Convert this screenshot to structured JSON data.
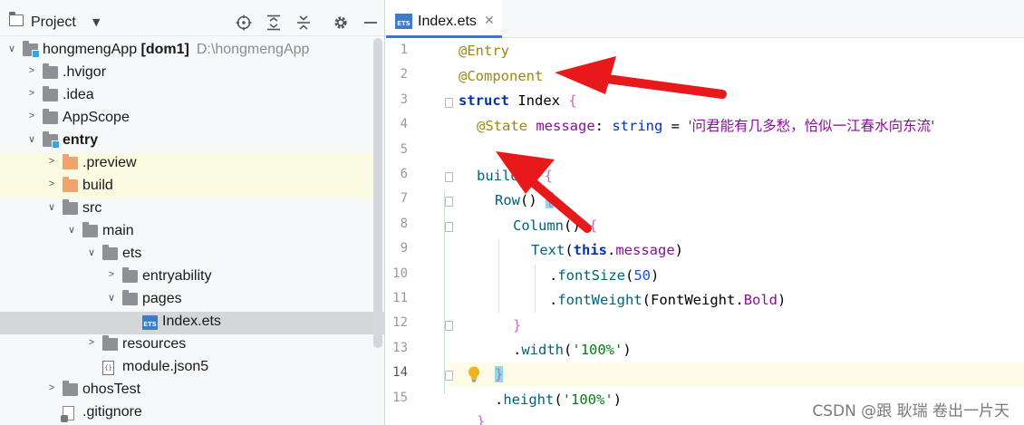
{
  "project_panel": {
    "title": "Project",
    "tree": [
      {
        "depth": 0,
        "arrow": "expanded",
        "icon": "module-folder",
        "label": "hongmengApp",
        "suffix": "[dom1]",
        "hint": "D:\\hongmengApp"
      },
      {
        "depth": 1,
        "arrow": "collapsed",
        "icon": "folder",
        "label": ".hvigor"
      },
      {
        "depth": 1,
        "arrow": "collapsed",
        "icon": "folder",
        "label": ".idea"
      },
      {
        "depth": 1,
        "arrow": "collapsed",
        "icon": "folder",
        "label": "AppScope"
      },
      {
        "depth": 1,
        "arrow": "expanded",
        "icon": "module-folder",
        "label": "entry",
        "bold": true
      },
      {
        "depth": 2,
        "arrow": "collapsed",
        "icon": "folder-orange",
        "label": ".preview",
        "highlight": true
      },
      {
        "depth": 2,
        "arrow": "collapsed",
        "icon": "folder-orange",
        "label": "build",
        "highlight": true
      },
      {
        "depth": 2,
        "arrow": "expanded",
        "icon": "folder",
        "label": "src"
      },
      {
        "depth": 3,
        "arrow": "expanded",
        "icon": "folder",
        "label": "main"
      },
      {
        "depth": 4,
        "arrow": "expanded",
        "icon": "folder",
        "label": "ets"
      },
      {
        "depth": 5,
        "arrow": "collapsed",
        "icon": "folder",
        "label": "entryability"
      },
      {
        "depth": 5,
        "arrow": "expanded",
        "icon": "folder",
        "label": "pages"
      },
      {
        "depth": 6,
        "arrow": "none",
        "icon": "ets-file",
        "label": "Index.ets",
        "selected": true
      },
      {
        "depth": 4,
        "arrow": "collapsed",
        "icon": "folder",
        "label": "resources"
      },
      {
        "depth": 4,
        "arrow": "none",
        "icon": "json-file",
        "label": "module.json5"
      },
      {
        "depth": 2,
        "arrow": "collapsed",
        "icon": "folder",
        "label": "ohosTest"
      },
      {
        "depth": 2,
        "arrow": "none",
        "icon": "git-file",
        "label": ".gitignore"
      }
    ]
  },
  "editor": {
    "tab": {
      "label": "Index.ets",
      "icon_text": "ETS"
    },
    "line_numbers": [
      "1",
      "2",
      "3",
      "4",
      "5",
      "6",
      "7",
      "8",
      "9",
      "10",
      "11",
      "12",
      "13",
      "14",
      "15"
    ],
    "current_line": "14"
  },
  "code": {
    "l1_ann": "@Entry",
    "l2_ann": "@Component",
    "l3_kw": "struct",
    "l3_name": " Index ",
    "l3_brace": "{",
    "l4_ann": "@State",
    "l4_prop": " message",
    "l4_colon": ": ",
    "l4_type": "string",
    "l4_eq": " = ",
    "l4_str": "'问君能有几多愁，恰似一江春水向东流'",
    "l6_kw": "build",
    "l6_paren": "() ",
    "l6_brace": "{",
    "l7_fn": "Row",
    "l7_paren": "() ",
    "l7_brace": "{",
    "l8_fn": "Column",
    "l8_paren": "() ",
    "l8_brace": "{",
    "l9_fn": "Text",
    "l9_open": "(",
    "l9_this": "this",
    "l9_dot": ".",
    "l9_prop": "message",
    "l9_close": ")",
    "l10_dot": ".",
    "l10_fn": "fontSize",
    "l10_open": "(",
    "l10_num": "50",
    "l10_close": ")",
    "l11_dot": ".",
    "l11_fn": "fontWeight",
    "l11_open": "(",
    "l11_cls": "FontWeight",
    "l11_dot2": ".",
    "l11_prop": "Bold",
    "l11_close": ")",
    "l12_brace": "}",
    "l13_dot": ".",
    "l13_fn": "width",
    "l13_open": "(",
    "l13_str": "'100%'",
    "l13_close": ")",
    "l14_brace": "}",
    "l15_dot": ".",
    "l15_fn": "height",
    "l15_open": "(",
    "l15_str": "'100%'",
    "l15_close": ")",
    "l16_brace": "}"
  },
  "watermark": "CSDN @跟 耿瑞 卷出一片天",
  "colors": {
    "arrow_red": "#e8191b",
    "tab_underline": "#3574f0"
  }
}
